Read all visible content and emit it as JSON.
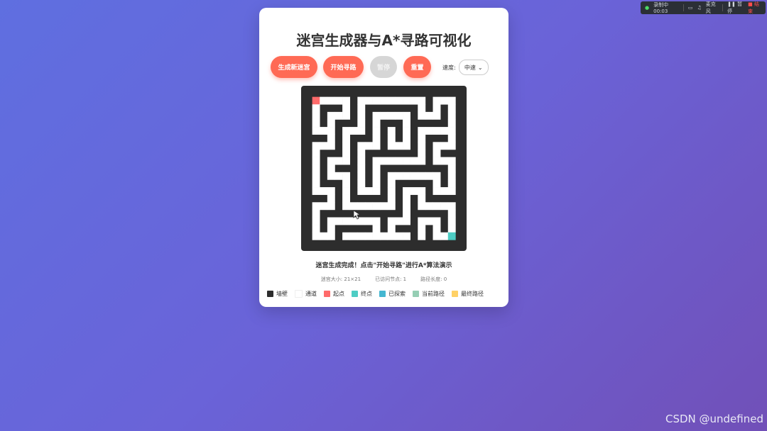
{
  "recorder": {
    "status_text": "录制中 00:03",
    "mic_label": "麦克风",
    "pause_label": "暂停",
    "stop_label": "结束"
  },
  "app": {
    "title": "迷宫生成器与A*寻路可视化"
  },
  "controls": {
    "generate_label": "生成新迷宫",
    "start_label": "开始寻路",
    "pause_label": "暂停",
    "reset_label": "重置",
    "speed_label": "速度:",
    "speed_value": "中速"
  },
  "status": {
    "message": "迷宫生成完成！点击\"开始寻路\"进行A*算法演示"
  },
  "stats": {
    "maze_size": "迷宫大小: 21×21",
    "visited": "已访问节点: 1",
    "path_length": "路径长度: 0"
  },
  "legend": [
    {
      "label": "墙壁",
      "color": "#2d2d2d"
    },
    {
      "label": "通道",
      "color": "#ffffff"
    },
    {
      "label": "起点",
      "color": "#ff6b6b"
    },
    {
      "label": "终点",
      "color": "#4ecdc4"
    },
    {
      "label": "已探索",
      "color": "#45b7d1"
    },
    {
      "label": "当前路径",
      "color": "#96ceb4"
    },
    {
      "label": "最终路径",
      "color": "#ffd166"
    }
  ],
  "colors": {
    "accent": "#ff6a55",
    "wall": "#2d2d2d",
    "path": "#ffffff",
    "start": "#ff6b6b",
    "end": "#4ecdc4"
  },
  "maze": {
    "rows": [
      "#####################",
      "#S....#.........#...#",
      "#.###.#.#######.#.#.#",
      "#.#...#.#.....#...#.#",
      "#.#.###.#.###.#####.#",
      "#...#...#.#.#.#.....#",
      "###.#.###.#.#.#.###.#",
      "#...#.#...#...#.#...#",
      "#.###.#.#######.#.###",
      "#.#...#.#.......#...#",
      "#.#.###.#.#########.#",
      "#.#...#.#.#.......#.#",
      "#.###.#.#.#.#####.#.#",
      "#...#.#...#.#...#...#",
      "###.#.#####.#.#.#####",
      "#...#.......#.#.....#",
      "#.###########.#####.#",
      "#.#.......#...#...#.#",
      "#.#.#####.#.###.#.#.#",
      "#...#.........#.#..E#",
      "#####################"
    ]
  }
}
